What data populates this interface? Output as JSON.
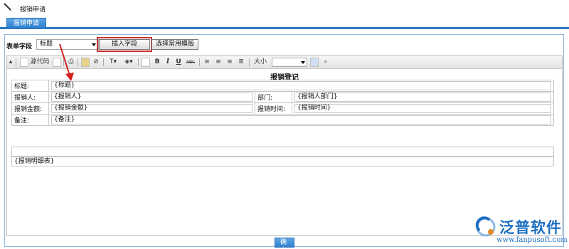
{
  "window": {
    "title": "报销申请"
  },
  "tabs": [
    {
      "label": "报销申请"
    }
  ],
  "field_row": {
    "label": "表单字段",
    "select_value": "标题",
    "insert_button": "插入字段",
    "template_button": "选择常用模版"
  },
  "toolbar": {
    "source_label": "源代码",
    "bold": "B",
    "italic": "I",
    "underline": "U",
    "strike": "ABC",
    "size_label": "大小"
  },
  "form": {
    "title": "报销登记",
    "rows": [
      {
        "label": "标题:",
        "value": "{标题}"
      },
      {
        "label": "报销人:",
        "value": "{报销人}",
        "label2": "部门:",
        "value2": "{报销人部门}"
      },
      {
        "label": "报销金额:",
        "value": "{报销金额}",
        "label2": "报销时间:",
        "value2": "{报销时间}"
      },
      {
        "label": "备注:",
        "value": "{备注}"
      }
    ],
    "detail": "{报销明细表}"
  },
  "confirm_button": "确 定",
  "watermark": {
    "name": "泛普软件",
    "url": "www.fanpusoft.com"
  },
  "colors": {
    "accent": "#2e78c0",
    "highlight": "#c83232",
    "logo": "#1d6fc0"
  }
}
